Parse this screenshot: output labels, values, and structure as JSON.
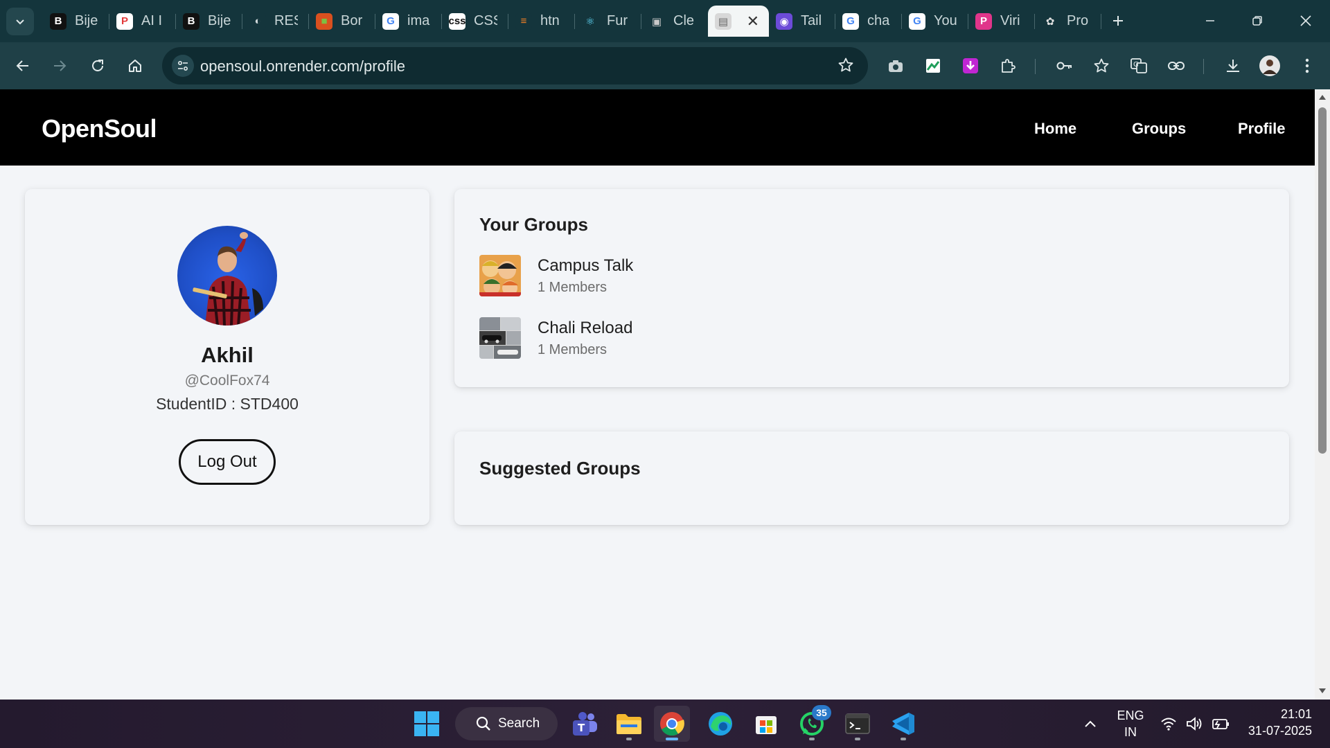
{
  "browser": {
    "tabs": [
      {
        "title": "Bije",
        "icon": "bijeta-logo-icon",
        "fav_text": "B",
        "fav_bg": "#111111",
        "fav_fg": "#ffffff"
      },
      {
        "title": "AI I",
        "icon": "p-logo-icon",
        "fav_text": "P",
        "fav_bg": "#ffffff",
        "fav_fg": "#e23b3b"
      },
      {
        "title": "Bije",
        "icon": "bijeta-logo-icon",
        "fav_text": "B",
        "fav_bg": "#111111",
        "fav_fg": "#ffffff"
      },
      {
        "title": "RES",
        "icon": "globe-icon",
        "fav_text": "◐",
        "fav_bg": "#14353c",
        "fav_fg": "#d0d8da"
      },
      {
        "title": "Bor",
        "icon": "square-logo-icon",
        "fav_text": "■",
        "fav_bg": "#d9501f",
        "fav_fg": "#7cc043"
      },
      {
        "title": "ima",
        "icon": "google-icon",
        "fav_text": "G",
        "fav_bg": "#ffffff",
        "fav_fg": "#4285f4"
      },
      {
        "title": "CSS",
        "icon": "css-icon",
        "fav_text": "css",
        "fav_bg": "#ffffff",
        "fav_fg": "#111111"
      },
      {
        "title": "htn",
        "icon": "stackoverflow-icon",
        "fav_text": "≡",
        "fav_bg": "#14353c",
        "fav_fg": "#f48024"
      },
      {
        "title": "Fur",
        "icon": "react-icon",
        "fav_text": "⚛",
        "fav_bg": "#14353c",
        "fav_fg": "#61dafb"
      },
      {
        "title": "Cle",
        "icon": "app-icon",
        "fav_text": "▣",
        "fav_bg": "#14353c",
        "fav_fg": "#c9c9c9"
      },
      {
        "title": "",
        "icon": "page-icon",
        "fav_text": "▤",
        "fav_bg": "#d8d8d8",
        "fav_fg": "#666666",
        "active": true
      },
      {
        "title": "Tail",
        "icon": "chat-icon",
        "fav_text": "◉",
        "fav_bg": "#6c4bd8",
        "fav_fg": "#ffffff"
      },
      {
        "title": "cha",
        "icon": "google-icon",
        "fav_text": "G",
        "fav_bg": "#ffffff",
        "fav_fg": "#4285f4"
      },
      {
        "title": "You",
        "icon": "google-icon",
        "fav_text": "G",
        "fav_bg": "#ffffff",
        "fav_fg": "#4285f4"
      },
      {
        "title": "Viri",
        "icon": "p-logo-icon",
        "fav_text": "P",
        "fav_bg": "#e0358a",
        "fav_fg": "#ffffff"
      },
      {
        "title": "Pro",
        "icon": "openai-icon",
        "fav_text": "✿",
        "fav_bg": "#14353c",
        "fav_fg": "#e0e0e0"
      }
    ],
    "url": "opensoul.onrender.com/profile"
  },
  "site": {
    "brand": "OpenSoul",
    "nav": {
      "home": "Home",
      "groups": "Groups",
      "profile": "Profile"
    }
  },
  "profile": {
    "name": "Akhil",
    "handle": "@CoolFox74",
    "student_id": "StudentID : STD400",
    "logout_label": "Log Out"
  },
  "your_groups": {
    "title": "Your Groups",
    "items": [
      {
        "name": "Campus Talk",
        "members": "1 Members"
      },
      {
        "name": "Chali Reload",
        "members": "1 Members"
      }
    ]
  },
  "suggested_groups": {
    "title": "Suggested Groups"
  },
  "taskbar": {
    "search_label": "Search",
    "whatsapp_badge": "35",
    "lang_top": "ENG",
    "lang_bottom": "IN",
    "time": "21:01",
    "date": "31-07-2025"
  },
  "colors": {
    "nav_bg": "#000000",
    "page_bg": "#f3f5f8",
    "chrome_tabbar": "#14353c",
    "chrome_toolbar": "#1f4047"
  }
}
